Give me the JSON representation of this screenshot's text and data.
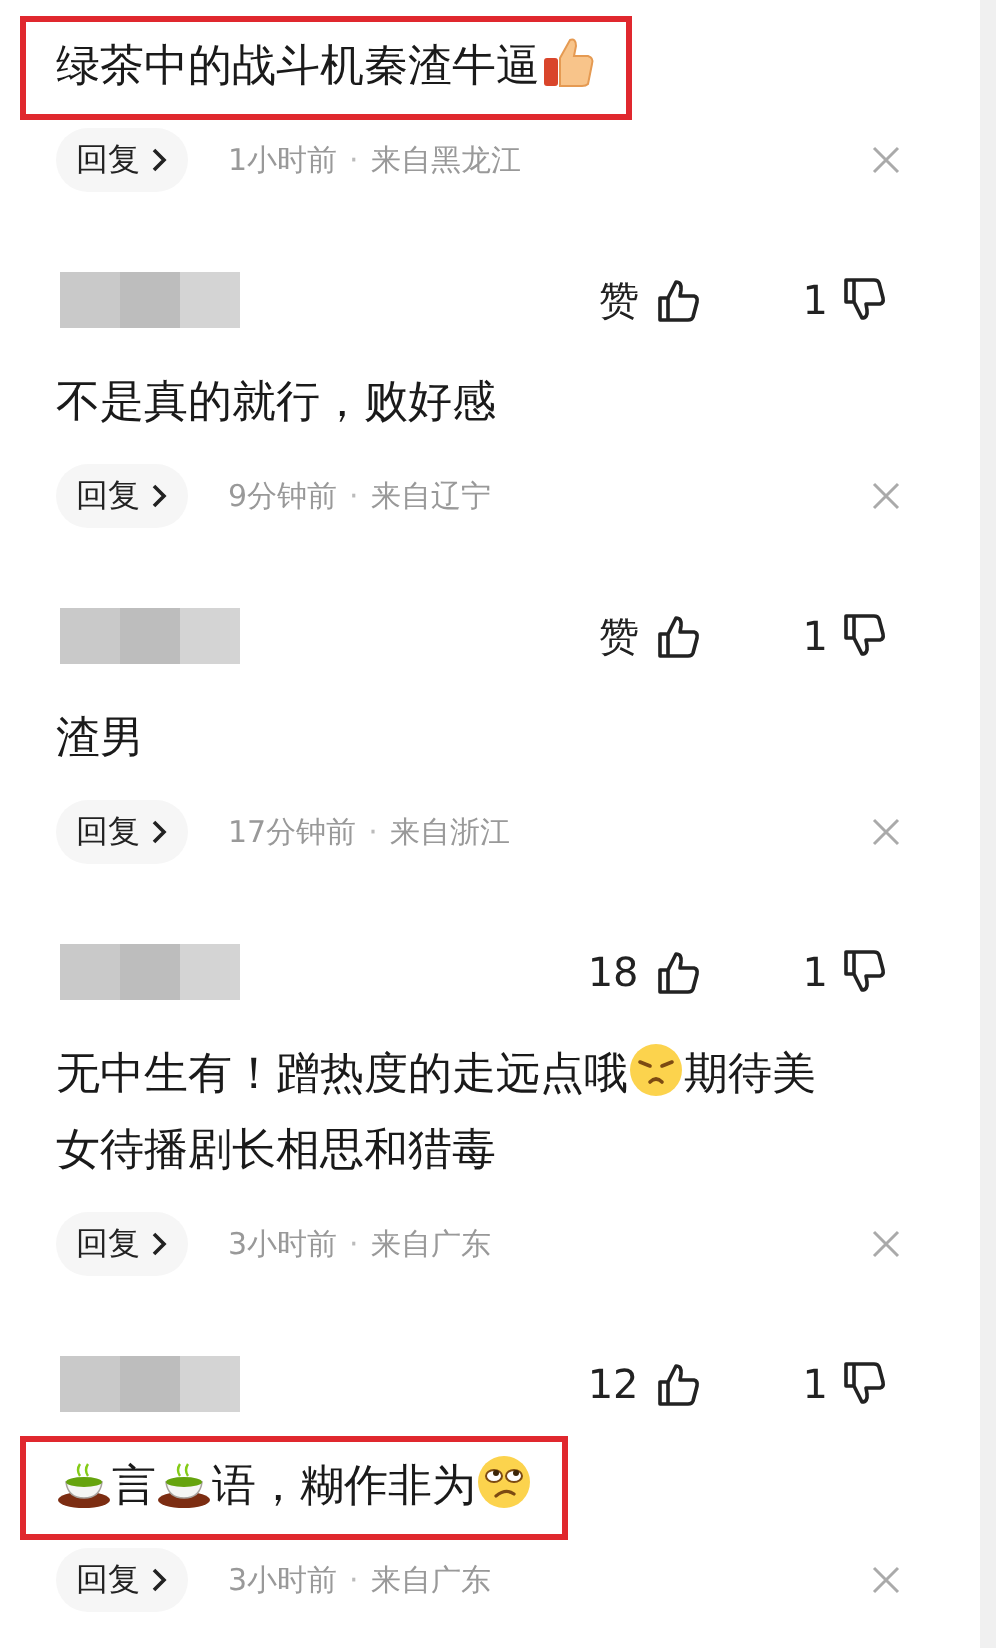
{
  "comments": [
    {
      "highlighted": true,
      "body": [
        {
          "kind": "text",
          "text": "绿茶中的战斗机秦渣牛逼"
        },
        {
          "kind": "thumb"
        }
      ],
      "reply": "回复",
      "time": "1小时前",
      "sep": "·",
      "location": "来自黑龙江"
    },
    {
      "highlighted": false,
      "likes": "赞",
      "dislikes": "1",
      "body": [
        {
          "kind": "text",
          "text": "不是真的就行，败好感"
        }
      ],
      "reply": "回复",
      "time": "9分钟前",
      "sep": "·",
      "location": "来自辽宁"
    },
    {
      "highlighted": false,
      "likes": "赞",
      "dislikes": "1",
      "body": [
        {
          "kind": "text",
          "text": "渣男"
        }
      ],
      "reply": "回复",
      "time": "17分钟前",
      "sep": "·",
      "location": "来自浙江"
    },
    {
      "highlighted": false,
      "likes": "18",
      "dislikes": "1",
      "body": [
        {
          "kind": "text",
          "text": "无中生有！蹭热度的走远点哦"
        },
        {
          "kind": "grimace"
        },
        {
          "kind": "text",
          "text": "期待美女待播剧长相思和猎毒"
        }
      ],
      "reply": "回复",
      "time": "3小时前",
      "sep": "·",
      "location": "来自广东"
    },
    {
      "highlighted": true,
      "likes": "12",
      "dislikes": "1",
      "body": [
        {
          "kind": "tea"
        },
        {
          "kind": "text",
          "text": "言"
        },
        {
          "kind": "tea"
        },
        {
          "kind": "text",
          "text": "语，糊作非为"
        },
        {
          "kind": "eyeroll"
        }
      ],
      "reply": "回复",
      "time": "3小时前",
      "sep": "·",
      "location": "来自广东"
    }
  ]
}
